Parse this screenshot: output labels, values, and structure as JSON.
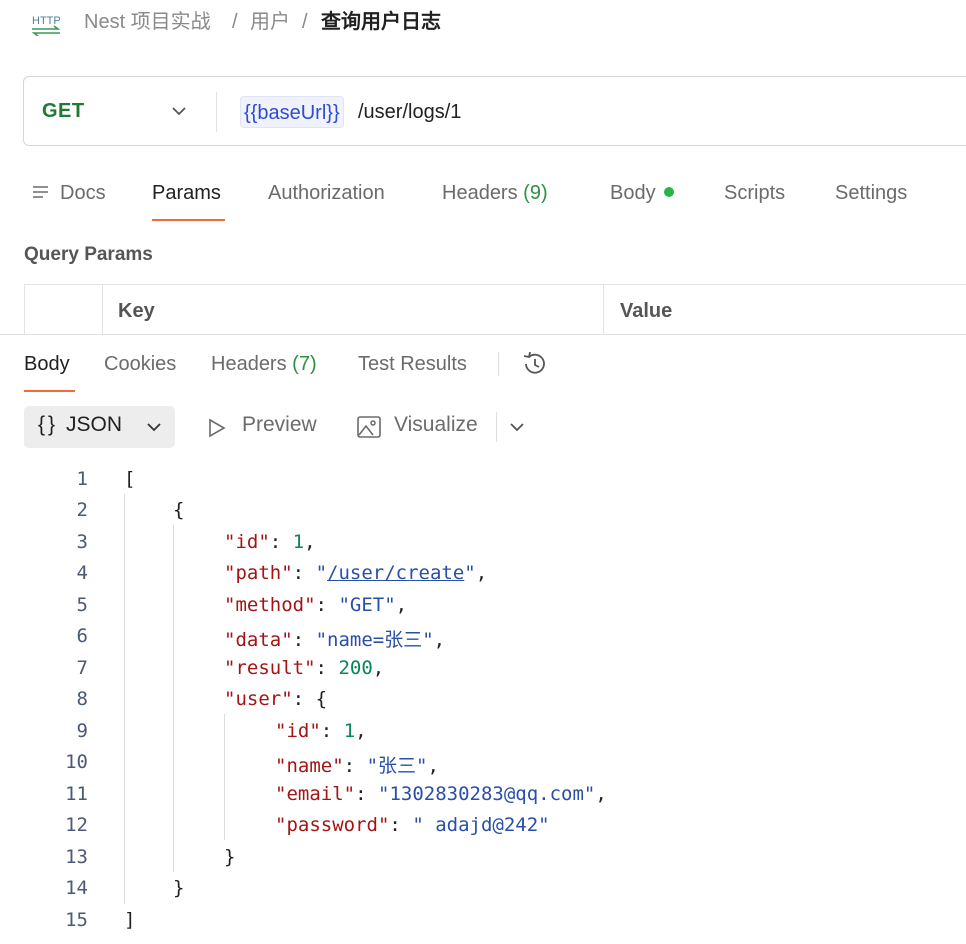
{
  "breadcrumb": {
    "icon_label": "HTTP",
    "collection": "Nest 项目实战",
    "sep1": "/",
    "folder": "用户",
    "sep2": "/",
    "request": "查询用户日志"
  },
  "request": {
    "method": "GET",
    "url_variable": "{{baseUrl}}",
    "url_path": "/user/logs/1"
  },
  "request_tabs": {
    "docs": "Docs",
    "params": "Params",
    "authorization": "Authorization",
    "headers": "Headers",
    "headers_count": "(9)",
    "body": "Body",
    "scripts": "Scripts",
    "settings": "Settings"
  },
  "query_params": {
    "title": "Query Params",
    "key_header": "Key",
    "value_header": "Value"
  },
  "response_tabs": {
    "body": "Body",
    "cookies": "Cookies",
    "headers": "Headers",
    "headers_count": "(7)",
    "test_results": "Test Results"
  },
  "response_toolbar": {
    "format": "JSON",
    "preview": "Preview",
    "visualize": "Visualize"
  },
  "colors": {
    "accent": "#f26b3a",
    "method_get": "#1f7a34",
    "count_green": "#2f8f47",
    "body_dot": "#28b446"
  },
  "code": {
    "line_numbers": [
      "1",
      "2",
      "3",
      "4",
      "5",
      "6",
      "7",
      "8",
      "9",
      "10",
      "11",
      "12",
      "13",
      "14",
      "15"
    ],
    "l1": "[",
    "l2": "{",
    "l3_key": "id",
    "l3_val": "1",
    "l4_key": "path",
    "l4_val": "/user/create",
    "l5_key": "method",
    "l5_val": "GET",
    "l6_key": "data",
    "l6_val": "name=张三",
    "l7_key": "result",
    "l7_val": "200",
    "l8_key": "user",
    "l8_open": "{",
    "l9_key": "id",
    "l9_val": "1",
    "l10_key": "name",
    "l10_val": "张三",
    "l11_key": "email",
    "l11_val": "1302830283@qq.com",
    "l12_key": "password",
    "l12_val": " adajd@242",
    "l13": "}",
    "l14": "}",
    "l15": "]"
  }
}
